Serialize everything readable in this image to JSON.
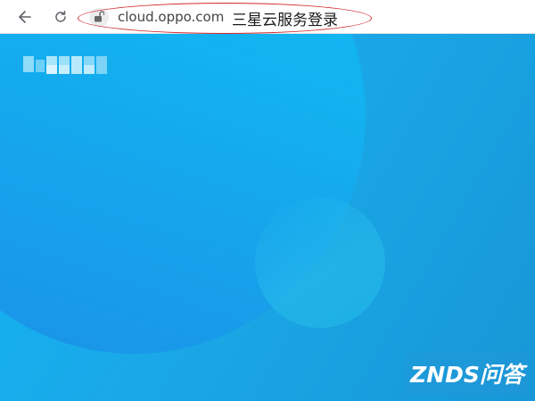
{
  "browser": {
    "url": "cloud.oppo.com",
    "annotation": "三星云服务登录",
    "annotation_color": "#d0272b"
  },
  "page": {
    "logo_label": "",
    "hero_color": "#12b4f2"
  },
  "watermark": {
    "text": "ZNDS问答"
  },
  "icons": {
    "back": "arrow-left-icon",
    "reload": "reload-icon",
    "lock": "lock-icon"
  }
}
